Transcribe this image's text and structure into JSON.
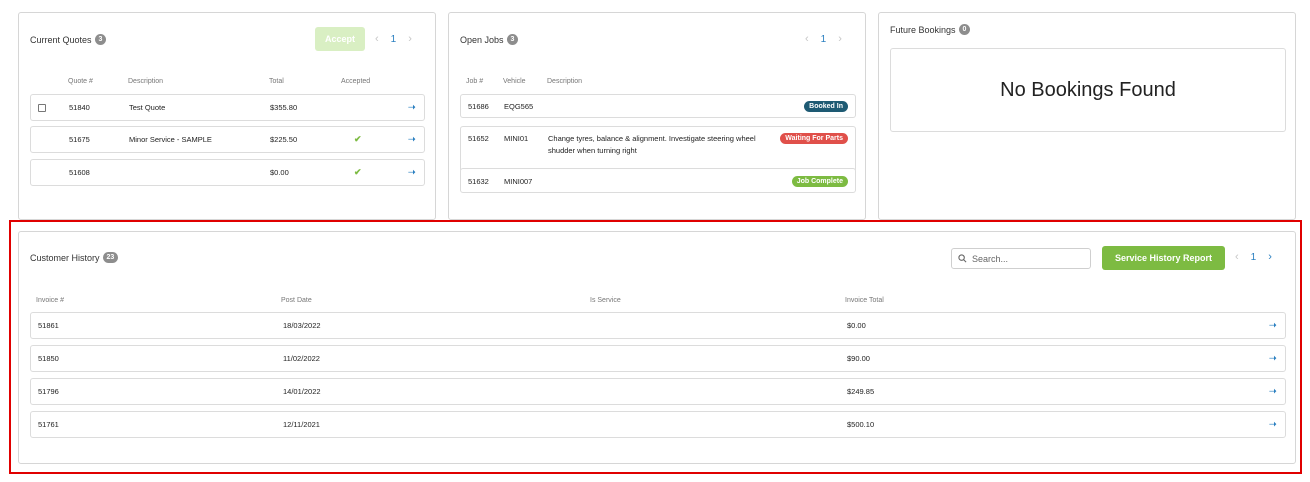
{
  "current_quotes": {
    "title": "Current Quotes",
    "count": "3",
    "accept_label": "Accept",
    "page": "1",
    "columns": [
      "Quote #",
      "Description",
      "Total",
      "Accepted"
    ],
    "rows": [
      {
        "quote": "51840",
        "description": "Test Quote",
        "total": "$355.80",
        "accepted": false,
        "selectable": true
      },
      {
        "quote": "51675",
        "description": "Minor Service - SAMPLE",
        "total": "$225.50",
        "accepted": true,
        "selectable": false
      },
      {
        "quote": "51608",
        "description": "",
        "total": "$0.00",
        "accepted": true,
        "selectable": false
      }
    ]
  },
  "open_jobs": {
    "title": "Open Jobs",
    "count": "3",
    "page": "1",
    "columns": [
      "Job #",
      "Vehicle",
      "Description"
    ],
    "rows": [
      {
        "job": "51686",
        "vehicle": "EQG565",
        "description_line1": "",
        "description_line2": "",
        "status": "Booked In",
        "status_color": "#1e5a73"
      },
      {
        "job": "51652",
        "vehicle": "MINI01",
        "description_line1": "Change tyres, balance & alignment. Investigate steering wheel",
        "description_line2": "shudder when turning right",
        "status": "Waiting For Parts",
        "status_color": "#e0504a"
      },
      {
        "job": "51632",
        "vehicle": "MINI007",
        "description_line1": "",
        "description_line2": "",
        "status": "Job Complete",
        "status_color": "#7dbb42"
      }
    ]
  },
  "future_bookings": {
    "title": "Future Bookings",
    "count": "0",
    "empty_message": "No Bookings Found"
  },
  "customer_history": {
    "title": "Customer History",
    "count": "23",
    "search_placeholder": "Search...",
    "report_label": "Service History Report",
    "page": "1",
    "columns": [
      "Invoice #",
      "Post Date",
      "Is Service",
      "Invoice Total"
    ],
    "rows": [
      {
        "invoice": "51861",
        "post_date": "18/03/2022",
        "is_service": "",
        "total": "$0.00"
      },
      {
        "invoice": "51850",
        "post_date": "11/02/2022",
        "is_service": "",
        "total": "$90.00"
      },
      {
        "invoice": "51796",
        "post_date": "14/01/2022",
        "is_service": "",
        "total": "$249.85"
      },
      {
        "invoice": "51761",
        "post_date": "12/11/2021",
        "is_service": "",
        "total": "$500.10"
      }
    ]
  },
  "colors": {
    "accent_blue": "#2a7fc0",
    "accent_green": "#7dbb42",
    "highlight_red": "#e00000"
  },
  "icons": {
    "row_arrow": "arrow-right-icon",
    "accepted": "checkmark-icon",
    "search": "search-icon",
    "prev": "chevron-left-icon",
    "next": "chevron-right-icon"
  }
}
